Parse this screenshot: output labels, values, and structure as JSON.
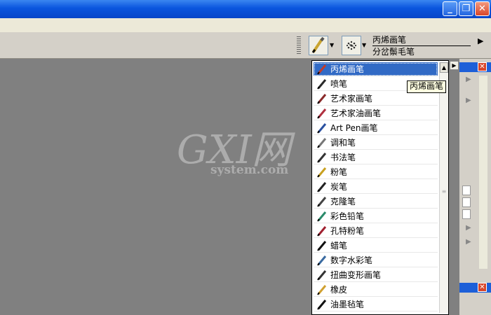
{
  "colors": {
    "titlebar": "#0a55de",
    "selection": "#316ac5",
    "canvas": "#808080",
    "panel": "#d4d0c8"
  },
  "window": {
    "minimize": "_",
    "maximize": "❐",
    "close": "✕"
  },
  "property_bar": {
    "brush_category": "丙烯画笔",
    "brush_variant": "分岔鬃毛笔",
    "expand": "▶"
  },
  "dropdown": {
    "tooltip": "丙烯画笔",
    "items": [
      {
        "label": "丙烯画笔",
        "icon": "acrylic-brush-icon",
        "selected": true
      },
      {
        "label": "喷笔",
        "icon": "airbrush-icon"
      },
      {
        "label": "艺术家画笔",
        "icon": "artist-brush-icon"
      },
      {
        "label": "艺术家油画笔",
        "icon": "artist-oil-brush-icon"
      },
      {
        "label": "Art Pen画笔",
        "icon": "art-pen-brush-icon"
      },
      {
        "label": "调和笔",
        "icon": "blender-icon"
      },
      {
        "label": "书法笔",
        "icon": "calligraphy-icon"
      },
      {
        "label": "粉笔",
        "icon": "chalk-icon"
      },
      {
        "label": "炭笔",
        "icon": "charcoal-icon"
      },
      {
        "label": "克隆笔",
        "icon": "cloner-icon"
      },
      {
        "label": "彩色铅笔",
        "icon": "colored-pencil-icon"
      },
      {
        "label": "孔特粉笔",
        "icon": "conte-icon"
      },
      {
        "label": "蜡笔",
        "icon": "crayon-icon"
      },
      {
        "label": "数字水彩笔",
        "icon": "digital-watercolor-icon"
      },
      {
        "label": "扭曲变形画笔",
        "icon": "distortion-icon"
      },
      {
        "label": "橡皮",
        "icon": "eraser-icon"
      },
      {
        "label": "油墨毡笔",
        "icon": "felt-pen-icon"
      }
    ]
  },
  "watermark": {
    "big": "GXI网",
    "small": "system.com"
  }
}
